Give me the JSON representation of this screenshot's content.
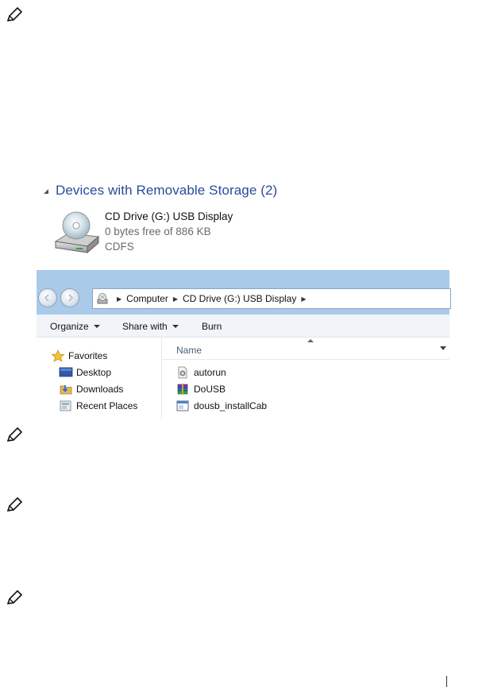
{
  "group": {
    "title": "Devices with Removable Storage (2)"
  },
  "drive": {
    "name": "CD Drive (G:) USB Display",
    "free_text": "0 bytes free of 886 KB",
    "filesystem": "CDFS",
    "icon": "cd-drive-icon"
  },
  "address_bar": {
    "crumbs": [
      "Computer",
      "CD Drive (G:) USB Display"
    ]
  },
  "toolbar": {
    "organize_label": "Organize",
    "share_label": "Share with",
    "burn_label": "Burn"
  },
  "nav_pane": {
    "items": [
      {
        "label": "Favorites",
        "icon": "star-icon"
      },
      {
        "label": "Desktop",
        "icon": "desktop-icon"
      },
      {
        "label": "Downloads",
        "icon": "downloads-icon"
      },
      {
        "label": "Recent Places",
        "icon": "recent-places-icon"
      }
    ]
  },
  "file_list": {
    "column_name": "Name",
    "files": [
      {
        "name": "autorun",
        "icon": "settings-file-icon"
      },
      {
        "name": "DoUSB",
        "icon": "archive-icon"
      },
      {
        "name": "dousb_installCab",
        "icon": "application-icon"
      }
    ]
  },
  "colors": {
    "titlebar": "#a9cbe9",
    "group_title": "#2b4a9a"
  }
}
